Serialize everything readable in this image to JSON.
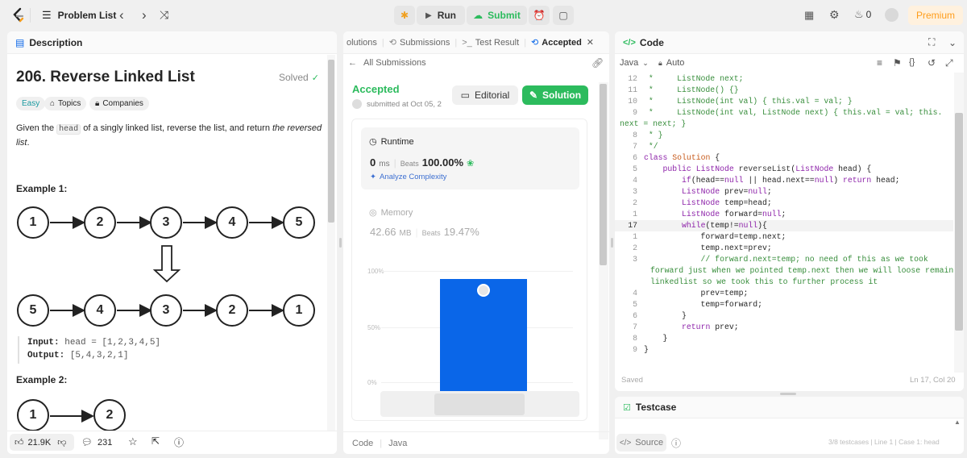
{
  "topbar": {
    "problem_list": "Problem List",
    "run": "Run",
    "submit": "Submit",
    "fire_count": "0",
    "premium": "Premium"
  },
  "description": {
    "tab": "Description",
    "title": "206. Reverse Linked List",
    "solved": "Solved",
    "tags": [
      "Easy",
      "Topics",
      "Companies"
    ],
    "text_pre": "Given the ",
    "text_code": "head",
    "text_mid": " of a singly linked list, reverse the list, and return ",
    "text_em1": "the reversed",
    "text_em2": "list",
    "text_end": ".",
    "example1": "Example 1:",
    "row1": [
      "1",
      "2",
      "3",
      "4",
      "5"
    ],
    "row2": [
      "5",
      "4",
      "3",
      "2",
      "1"
    ],
    "input_label": "Input:",
    "input_value": "head = [1,2,3,4,5]",
    "output_label": "Output:",
    "output_value": "[5,4,3,2,1]",
    "example2": "Example 2:",
    "row3": [
      "1",
      "2"
    ],
    "likes": "21.9K",
    "comments": "231"
  },
  "submission": {
    "tabs": [
      "olutions",
      "Submissions",
      "Test Result",
      "Accepted"
    ],
    "back": "All Submissions",
    "status": "Accepted",
    "submitted": "submitted at Oct 05, 2",
    "editorial": "Editorial",
    "solution": "Solution",
    "runtime_label": "Runtime",
    "runtime_value": "0",
    "runtime_unit": "ms",
    "beats_label": "Beats",
    "runtime_beats": "100.00%",
    "analyze": "Analyze Complexity",
    "memory_label": "Memory",
    "memory_value": "42.66",
    "memory_unit": "MB",
    "memory_beats": "19.47%",
    "ticks": [
      "100%",
      "50%",
      "0%"
    ],
    "footer_code": "Code",
    "footer_lang": "Java"
  },
  "chart_data": {
    "type": "bar",
    "ylim": [
      0,
      100
    ],
    "ticks": [
      "100%",
      "50%",
      "0%"
    ],
    "values": [
      100
    ]
  },
  "code": {
    "tab": "Code",
    "lang": "Java",
    "auto": "Auto",
    "saved": "Saved",
    "pos": "Ln 17, Col 20"
  },
  "testcase": {
    "tab": "Testcase",
    "source": "Source",
    "status": "3/8 testcases | Line 1 | Case 1: head"
  },
  "colors": {
    "accent": "#2cbb5d",
    "blue": "#0a66e8",
    "premium": "#ff9d1b",
    "keyword": "#8e24aa",
    "type": "#8e24aa",
    "comment": "#388e3c"
  }
}
